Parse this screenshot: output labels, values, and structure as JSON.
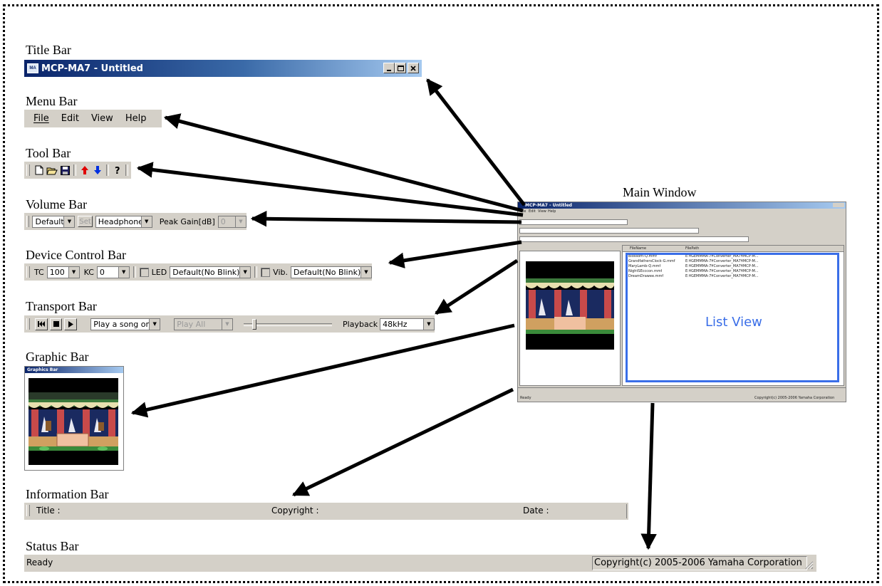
{
  "labels": {
    "title_bar": "Title Bar",
    "menu_bar": "Menu Bar",
    "tool_bar": "Tool Bar",
    "volume_bar": "Volume Bar",
    "device_control_bar": "Device Control Bar",
    "transport_bar": "Transport Bar",
    "graphic_bar": "Graphic Bar",
    "information_bar": "Information Bar",
    "status_bar": "Status Bar",
    "main_window": "Main Window"
  },
  "title_bar": {
    "app_title": "MCP-MA7 - Untitled",
    "icon": "mcp-app-icon"
  },
  "menu": {
    "file": "File",
    "edit": "Edit",
    "view": "View",
    "help": "Help"
  },
  "toolbar": {
    "icons": [
      "new-file-icon",
      "open-folder-icon",
      "save-disk-icon",
      "upload-arrow-icon",
      "download-arrow-icon",
      "help-icon"
    ]
  },
  "volume_bar": {
    "preset": "Default",
    "set_label": "Set",
    "output": "Headphone",
    "peak_gain_label": "Peak Gain[dB]",
    "peak_gain_value": "0"
  },
  "device_control": {
    "tc_label": "TC",
    "tc_value": "100",
    "kc_label": "KC",
    "kc_value": "0",
    "led_label": "LED",
    "led_value": "Default(No Blink)",
    "vib_label": "Vib.",
    "vib_value": "Default(No Blink)"
  },
  "transport": {
    "play_mode": "Play a song once",
    "play_all": "Play All",
    "playback_label": "Playback",
    "playback_value": "48kHz"
  },
  "graphic_bar": {
    "window_title": "Graphics Bar"
  },
  "info_bar": {
    "title_label": "Title :",
    "copyright_label": "Copyright :",
    "date_label": "Date :"
  },
  "status_bar": {
    "status": "Ready",
    "copyright": "Copyright(c) 2005-2006 Yamaha Corporation"
  },
  "main_window": {
    "title": "MCP-MA7 - Untitled",
    "menu": [
      "File",
      "Edit",
      "View",
      "Help"
    ],
    "list_columns": [
      "FileName",
      "FilePath"
    ],
    "list_rows": [
      {
        "name": "Blossom-Q.mmf",
        "path": "E:¥GEMMMA-7¥Converter_MA7¥MCP-M..."
      },
      {
        "name": "GrandfathersClock-G.mmf",
        "path": "E:¥GEMMMA-7¥Converter_MA7¥MCP-M..."
      },
      {
        "name": "MaryLamb-Q.mmf",
        "path": "E:¥GEMMMA-7¥Converter_MA7¥MCP-M..."
      },
      {
        "name": "NightSEcccon.mmf",
        "path": "E:¥GEMMMA-7¥Converter_MA7¥MCP-M..."
      },
      {
        "name": "DreamDrawee.mmf",
        "path": "E:¥GEMMMA-7¥Converter_MA7¥MCP-M..."
      }
    ],
    "list_view_label": "List View",
    "status": "Ready",
    "copyright": "Copyright(c) 2005-2006 Yamaha Corporation"
  },
  "colors": {
    "titlebar_start": "#0a246a",
    "titlebar_end": "#a6caf0",
    "list_view_highlight": "#3a6ee8",
    "toolbar_red": "#e00000",
    "toolbar_blue": "#0030e0"
  }
}
